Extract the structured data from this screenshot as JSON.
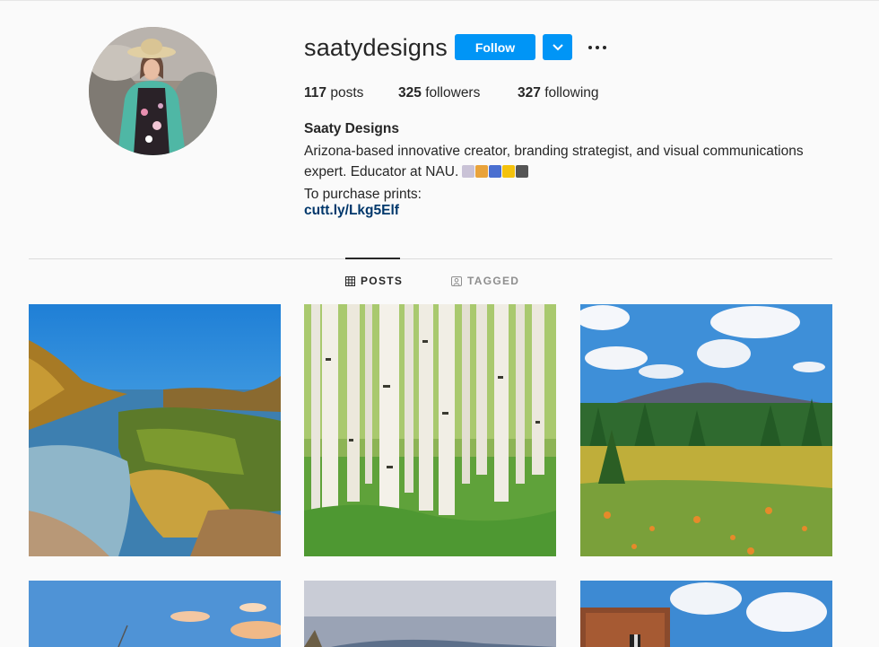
{
  "profile": {
    "username": "saatydesigns",
    "full_name": "Saaty Designs",
    "bio_line1": "Arizona-based innovative creator, branding strategist, and visual communications",
    "bio_line2": "expert. Educator at NAU.",
    "bio_line3": "To purchase prints:",
    "link": "cutt.ly/Lkg5Elf"
  },
  "actions": {
    "follow_label": "Follow",
    "dropdown_icon": "chevron-down-icon",
    "more_icon": "ellipsis-icon"
  },
  "stats": {
    "posts_count": "117",
    "posts_label": "posts",
    "followers_count": "325",
    "followers_label": "followers",
    "following_count": "327",
    "following_label": "following"
  },
  "tabs": {
    "posts_label": "POSTS",
    "tagged_label": "TAGGED"
  },
  "colors": {
    "accent": "#0095f6",
    "link": "#00376b",
    "background": "#fafafa"
  }
}
